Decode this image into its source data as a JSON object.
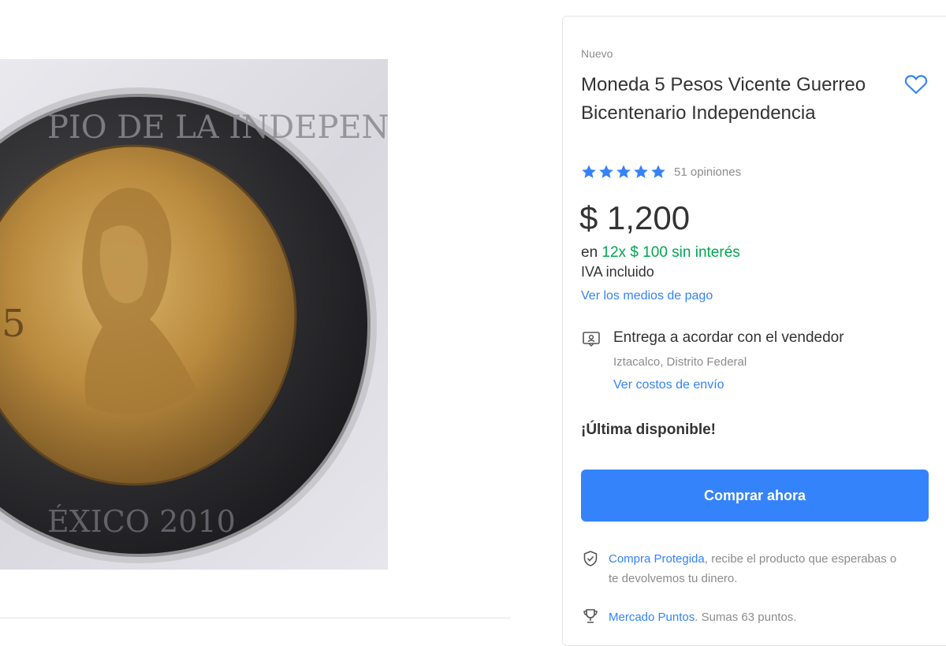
{
  "product": {
    "condition": "Nuevo",
    "title": "Moneda 5 Pesos Vicente Guerreo Bicentenario Independencia",
    "rating_stars": 5,
    "reviews": "51 opiniones",
    "price": "$ 1,200",
    "installments_prefix": "en",
    "installments_value": "12x $ 100 sin interés",
    "tax_note": "IVA incluido",
    "payment_link": "Ver los medios de pago"
  },
  "shipping": {
    "title": "Entrega a acordar con el vendedor",
    "location": "Iztacalco, Distrito Federal",
    "costs_link": "Ver costos de envío"
  },
  "stock_note": "¡Última disponible!",
  "buy_button": "Comprar ahora",
  "benefits": {
    "protected_link": "Compra Protegida",
    "protected_text": ", recibe el producto que esperabas o te devolvemos tu dinero.",
    "points_link": "Mercado Puntos",
    "points_text": ". Sumas 63 puntos."
  },
  "colors": {
    "accent": "#3483fa",
    "installments": "#00a650",
    "muted": "#8c8c8c",
    "text": "#333333"
  },
  "icons": [
    "heart-icon",
    "star-icon",
    "delivery-icon",
    "shield-icon",
    "trophy-icon"
  ]
}
